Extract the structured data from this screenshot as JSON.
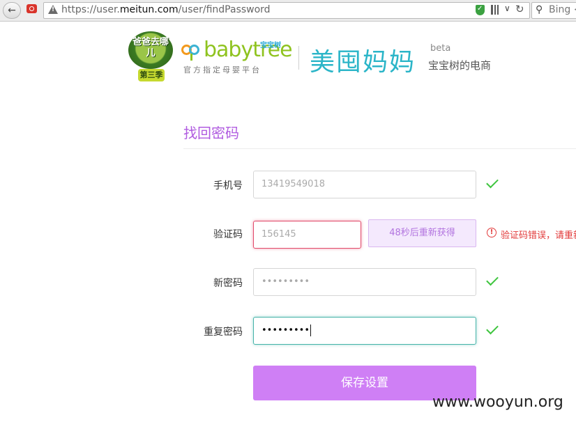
{
  "browser": {
    "url_prefix": "https://user.",
    "url_domain": "meitun.com",
    "url_path": "/user/findPassword",
    "search_placeholder": "Bing <"
  },
  "header": {
    "badge_title": "爸爸去哪儿",
    "badge_subtitle": "第三季",
    "babytree_name": "babytree",
    "babytree_cn": "宝宝树",
    "babytree_slogan": "官方指定母婴平台",
    "meitun_name": "美囤妈妈",
    "beta": "beta",
    "meitun_sub": "宝宝树的电商"
  },
  "form": {
    "title": "找回密码",
    "phone_label": "手机号",
    "phone_value": "13419549018",
    "code_label": "验证码",
    "code_value": "156145",
    "code_button": "48秒后重新获得",
    "code_error": "验证码错误，请重新",
    "newpw_label": "新密码",
    "newpw_value": "•••••••••",
    "repeat_label": "重复密码",
    "repeat_value": "•••••••••",
    "save_button": "保存设置"
  },
  "watermark": "www.wooyun.org"
}
